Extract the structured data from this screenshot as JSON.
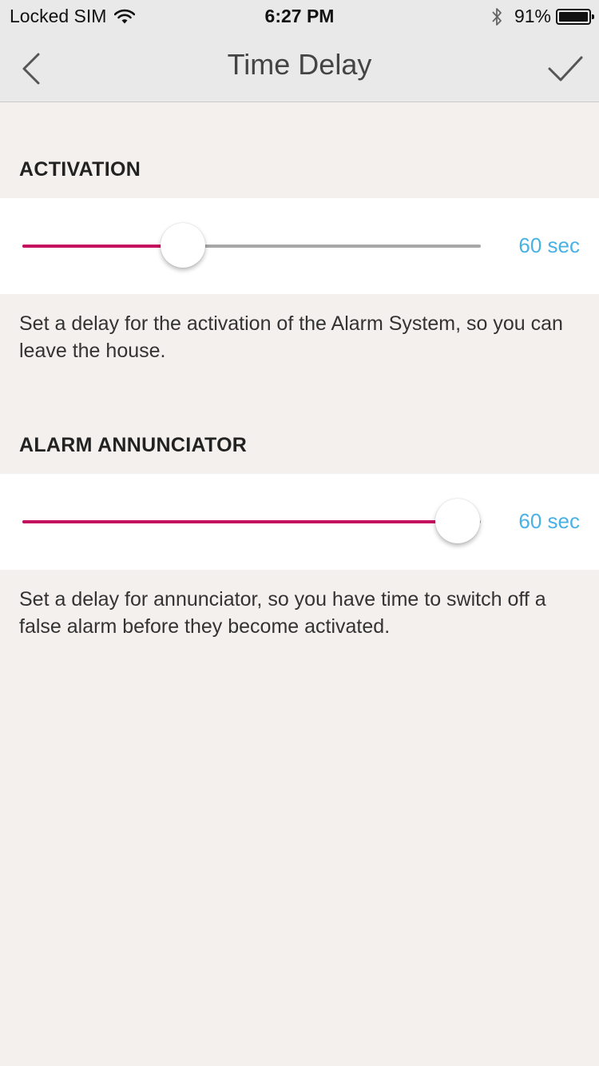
{
  "status_bar": {
    "carrier": "Locked SIM",
    "time": "6:27 PM",
    "battery": "91%"
  },
  "nav": {
    "title": "Time Delay",
    "back_icon": "chevron-left-icon",
    "confirm_icon": "checkmark-icon"
  },
  "sections": [
    {
      "title": "ACTIVATION",
      "slider_fraction": 0.35,
      "value": "60 sec",
      "description": "Set a delay for the activation of the Alarm System, so you can leave the house."
    },
    {
      "title": "ALARM ANNUNCIATOR",
      "slider_fraction": 0.95,
      "value": "60 sec",
      "description": "Set a delay for annunciator, so you have time to switch off a false alarm before they become activated."
    }
  ],
  "colors": {
    "accent": "#c4105e",
    "value_text": "#4ab1e4",
    "background": "#f4f0ed"
  }
}
